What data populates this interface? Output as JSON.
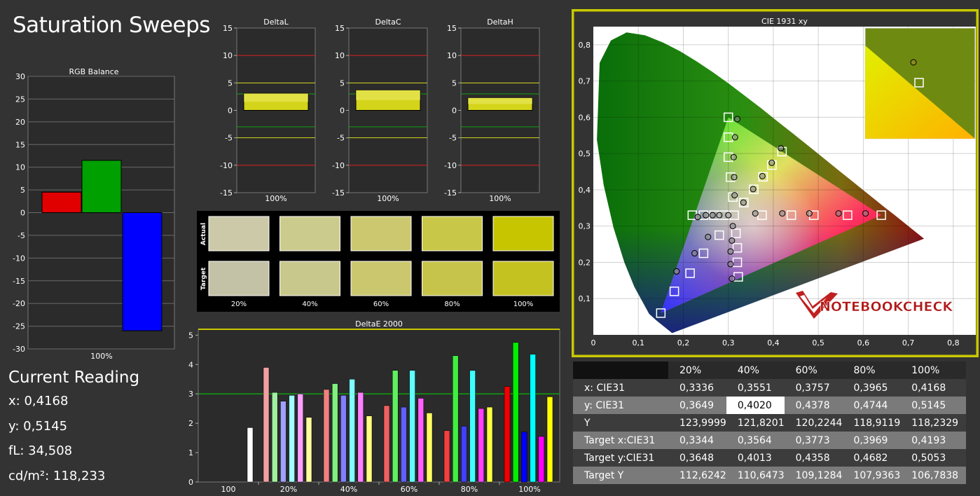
{
  "title": "Saturation Sweeps",
  "current_reading": {
    "header": "Current Reading",
    "x": "x: 0,4168",
    "y": "y: 0,5145",
    "fl": "fL: 34,508",
    "cd": "cd/m²: 118,233"
  },
  "colors": {
    "background": "#333333",
    "plot_bg": "#2b2b2b",
    "cie_border": "#c8c800",
    "red": "#e00000",
    "green": "#00a000",
    "blue": "#0000ff"
  },
  "watermark": "NOTEBOOKCHECK",
  "chart_data": [
    {
      "id": "rgb_balance",
      "type": "bar",
      "title": "RGB Balance",
      "categories": [
        "100%"
      ],
      "series": [
        {
          "name": "R",
          "values": [
            4.5
          ]
        },
        {
          "name": "G",
          "values": [
            11.5
          ]
        },
        {
          "name": "B",
          "values": [
            -26
          ]
        }
      ],
      "ylim": [
        -30,
        30
      ],
      "yticks": [
        30,
        25,
        20,
        15,
        10,
        5,
        0,
        -5,
        -10,
        -15,
        -20,
        -25,
        -30
      ],
      "grid": true
    },
    {
      "id": "delta_l",
      "type": "bar",
      "title": "DeltaL",
      "categories": [
        "100%"
      ],
      "values": [
        3.1
      ],
      "ylim": [
        -15,
        15
      ],
      "yticks": [
        15,
        10,
        5,
        0,
        -5,
        -10,
        -15
      ],
      "reference_lines": [
        {
          "y": 10,
          "color": "red"
        },
        {
          "y": 5,
          "color": "yellow"
        },
        {
          "y": 3,
          "color": "green"
        },
        {
          "y": -3,
          "color": "green"
        },
        {
          "y": -5,
          "color": "yellow"
        },
        {
          "y": -10,
          "color": "red"
        }
      ]
    },
    {
      "id": "delta_c",
      "type": "bar",
      "title": "DeltaC",
      "categories": [
        "100%"
      ],
      "values": [
        3.7
      ],
      "ylim": [
        -15,
        15
      ],
      "yticks": [
        15,
        10,
        5,
        0,
        -5,
        -10,
        -15
      ],
      "reference_lines": [
        {
          "y": 10,
          "color": "red"
        },
        {
          "y": 5,
          "color": "yellow"
        },
        {
          "y": 3,
          "color": "green"
        },
        {
          "y": -3,
          "color": "green"
        },
        {
          "y": -5,
          "color": "yellow"
        },
        {
          "y": -10,
          "color": "red"
        }
      ]
    },
    {
      "id": "delta_h",
      "type": "bar",
      "title": "DeltaH",
      "categories": [
        "100%"
      ],
      "values": [
        2.3
      ],
      "ylim": [
        -15,
        15
      ],
      "yticks": [
        15,
        10,
        5,
        0,
        -5,
        -10,
        -15
      ],
      "reference_lines": [
        {
          "y": 10,
          "color": "red"
        },
        {
          "y": 5,
          "color": "yellow"
        },
        {
          "y": 3,
          "color": "green"
        },
        {
          "y": -3,
          "color": "green"
        },
        {
          "y": -5,
          "color": "yellow"
        },
        {
          "y": -10,
          "color": "red"
        }
      ]
    },
    {
      "id": "swatches",
      "type": "table",
      "row_labels": [
        "Actual",
        "Target"
      ],
      "columns": [
        "20%",
        "40%",
        "60%",
        "80%",
        "100%"
      ],
      "actual_colors": [
        "#cbc9a7",
        "#cccb8e",
        "#cbc870",
        "#c9c747",
        "#c6c500"
      ],
      "target_colors": [
        "#c4c2a6",
        "#c9c88c",
        "#cac76e",
        "#c7c44c",
        "#c4c221"
      ]
    },
    {
      "id": "delta_e_2000",
      "type": "bar",
      "title": "DeltaE 2000",
      "categories": [
        "100",
        "20%",
        "40%",
        "60%",
        "80%",
        "100%"
      ],
      "ylim": [
        0,
        5.2
      ],
      "yticks": [
        0,
        1,
        2,
        3,
        4,
        5
      ],
      "threshold": 3,
      "groups": [
        {
          "values": [
            1.85
          ],
          "colors": [
            "#ffffff"
          ]
        },
        {
          "values": [
            3.9,
            3.05,
            2.75,
            2.95,
            3.0,
            2.2
          ],
          "colors": [
            "#f0a0a0",
            "#a0f0a0",
            "#a0a0ff",
            "#a0ffff",
            "#ffa0ff",
            "#ffffa0"
          ]
        },
        {
          "values": [
            3.15,
            3.35,
            2.95,
            3.5,
            3.05,
            2.25
          ],
          "colors": [
            "#f08080",
            "#80f080",
            "#8080ff",
            "#80ffff",
            "#ff80ff",
            "#ffff80"
          ]
        },
        {
          "values": [
            2.6,
            3.8,
            2.55,
            3.8,
            2.85,
            2.35
          ],
          "colors": [
            "#f06060",
            "#60f060",
            "#6060ff",
            "#60ffff",
            "#ff60ff",
            "#ffff60"
          ]
        },
        {
          "values": [
            1.75,
            4.3,
            1.9,
            3.8,
            2.5,
            2.55
          ],
          "colors": [
            "#f04040",
            "#40f040",
            "#4040ff",
            "#40ffff",
            "#ff40ff",
            "#ffff40"
          ]
        },
        {
          "values": [
            3.25,
            4.75,
            1.7,
            4.35,
            1.55,
            2.9
          ],
          "colors": [
            "#f00000",
            "#00f000",
            "#0000ff",
            "#00ffff",
            "#ff00ff",
            "#ffff00"
          ]
        }
      ]
    },
    {
      "id": "cie_1931",
      "type": "scatter",
      "title": "CIE 1931 xy",
      "xlim": [
        0,
        0.85
      ],
      "ylim": [
        0,
        0.85
      ],
      "xticks": [
        "0",
        "0,1",
        "0,2",
        "0,3",
        "0,4",
        "0,5",
        "0,6",
        "0,7",
        "0,8"
      ],
      "yticks": [
        "0,1",
        "0,2",
        "0,3",
        "0,4",
        "0,5",
        "0,6",
        "0,7",
        "0,8"
      ],
      "gamut_triangle": [
        [
          0.64,
          0.33
        ],
        [
          0.3,
          0.6
        ],
        [
          0.15,
          0.06
        ]
      ],
      "targets": [
        [
          0.64,
          0.33
        ],
        [
          0.565,
          0.33
        ],
        [
          0.49,
          0.33
        ],
        [
          0.44,
          0.33
        ],
        [
          0.375,
          0.33
        ],
        [
          0.3,
          0.6
        ],
        [
          0.3,
          0.545
        ],
        [
          0.3,
          0.49
        ],
        [
          0.305,
          0.435
        ],
        [
          0.31,
          0.38
        ],
        [
          0.15,
          0.06
        ],
        [
          0.18,
          0.12
        ],
        [
          0.215,
          0.17
        ],
        [
          0.245,
          0.225
        ],
        [
          0.28,
          0.275
        ],
        [
          0.22,
          0.33
        ],
        [
          0.245,
          0.33
        ],
        [
          0.268,
          0.33
        ],
        [
          0.29,
          0.33
        ],
        [
          0.313,
          0.33
        ],
        [
          0.317,
          0.28
        ],
        [
          0.32,
          0.24
        ],
        [
          0.32,
          0.2
        ],
        [
          0.322,
          0.16
        ],
        [
          0.3344,
          0.3648
        ],
        [
          0.3564,
          0.4013
        ],
        [
          0.3773,
          0.4358
        ],
        [
          0.3969,
          0.4682
        ],
        [
          0.4193,
          0.5053
        ]
      ],
      "measured": [
        [
          0.605,
          0.335
        ],
        [
          0.545,
          0.335
        ],
        [
          0.48,
          0.335
        ],
        [
          0.42,
          0.335
        ],
        [
          0.36,
          0.335
        ],
        [
          0.32,
          0.595
        ],
        [
          0.315,
          0.545
        ],
        [
          0.312,
          0.49
        ],
        [
          0.313,
          0.435
        ],
        [
          0.314,
          0.385
        ],
        [
          0.185,
          0.175
        ],
        [
          0.185,
          0.175
        ],
        [
          0.225,
          0.225
        ],
        [
          0.255,
          0.27
        ],
        [
          0.232,
          0.325
        ],
        [
          0.232,
          0.325
        ],
        [
          0.25,
          0.33
        ],
        [
          0.265,
          0.33
        ],
        [
          0.28,
          0.33
        ],
        [
          0.3,
          0.33
        ],
        [
          0.31,
          0.3
        ],
        [
          0.308,
          0.26
        ],
        [
          0.305,
          0.23
        ],
        [
          0.305,
          0.195
        ],
        [
          0.308,
          0.155
        ],
        [
          0.3336,
          0.3649
        ],
        [
          0.3551,
          0.402
        ],
        [
          0.3757,
          0.4378
        ],
        [
          0.3965,
          0.4744
        ],
        [
          0.4168,
          0.5145
        ]
      ]
    }
  ],
  "cie_table": {
    "headers": [
      "",
      "20%",
      "40%",
      "60%",
      "80%",
      "100%"
    ],
    "rows": [
      {
        "label": "x: CIE31",
        "values": [
          "0,3336",
          "0,3551",
          "0,3757",
          "0,3965",
          "0,4168"
        ]
      },
      {
        "label": "y: CIE31",
        "values": [
          "0,3649",
          "0,4020",
          "0,4378",
          "0,4744",
          "0,5145"
        ]
      },
      {
        "label": "Y",
        "values": [
          "123,9999",
          "121,8201",
          "120,2244",
          "118,9119",
          "118,2329"
        ]
      },
      {
        "label": "Target x:CIE31",
        "values": [
          "0,3344",
          "0,3564",
          "0,3773",
          "0,3969",
          "0,4193"
        ]
      },
      {
        "label": "Target y:CIE31",
        "values": [
          "0,3648",
          "0,4013",
          "0,4358",
          "0,4682",
          "0,5053"
        ]
      },
      {
        "label": "Target Y",
        "values": [
          "112,6242",
          "110,6473",
          "109,1284",
          "107,9363",
          "106,7838"
        ]
      }
    ]
  }
}
